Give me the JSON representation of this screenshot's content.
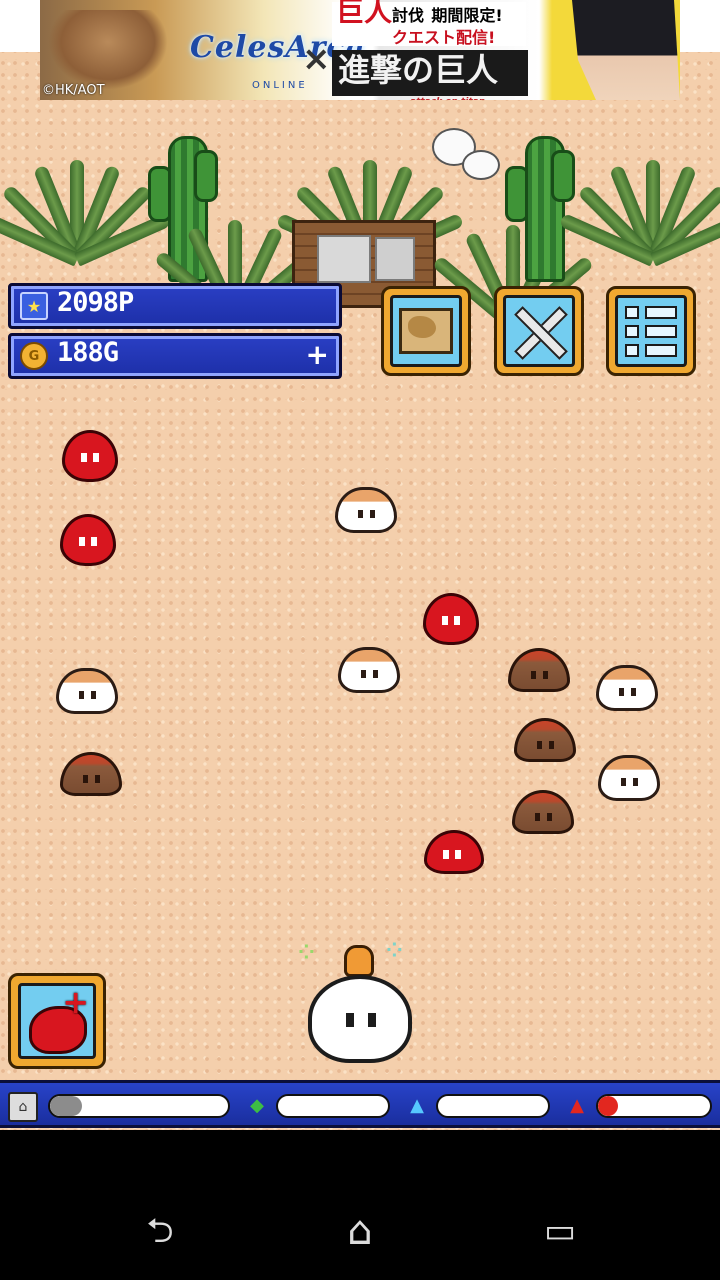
{
  "banner": {
    "copyright": "©HK/AOT",
    "game_logo": "CelesArca",
    "game_logo_sub": "ONLINE",
    "cross": "×",
    "promo_line_1": "巨人",
    "promo_line_1b": "討伐",
    "promo_line_1c": "期間限定!",
    "promo_line_2": "クエスト配信!",
    "collab_title": "進撃の巨人",
    "collab_subtitle": "attack on titan"
  },
  "hud": {
    "points_icon": "star-icon",
    "points": "2098P",
    "gold_icon": "coin-icon",
    "gold": "188G",
    "gold_add": "+"
  },
  "menu": [
    {
      "name": "map-button",
      "icon": "map-icon"
    },
    {
      "name": "battle-button",
      "icon": "crossed-swords-icon"
    },
    {
      "name": "list-menu-button",
      "icon": "list-icon"
    }
  ],
  "feed_button": {
    "icon": "meat-icon",
    "plus": "+"
  },
  "status_gauges": [
    {
      "icon": "house-icon",
      "color": "#8c8c8c",
      "level": 0.18
    },
    {
      "icon": "leaf-drop-icon",
      "color": "#3dbd45",
      "level": 0.0
    },
    {
      "icon": "water-drop-icon",
      "color": "#56c8ff",
      "level": 0.0
    },
    {
      "icon": "fire-icon",
      "color": "#e2271f",
      "level": 0.1
    }
  ],
  "nav": {
    "back": "⮌",
    "home": "⌂",
    "recents": "▭"
  },
  "colors": {
    "sand": "#f4cfac",
    "hud_blue": "#1d2fa8",
    "button_frame": "#f0a830",
    "button_face": "#73cdf0",
    "slime_red": "#d8161f"
  }
}
